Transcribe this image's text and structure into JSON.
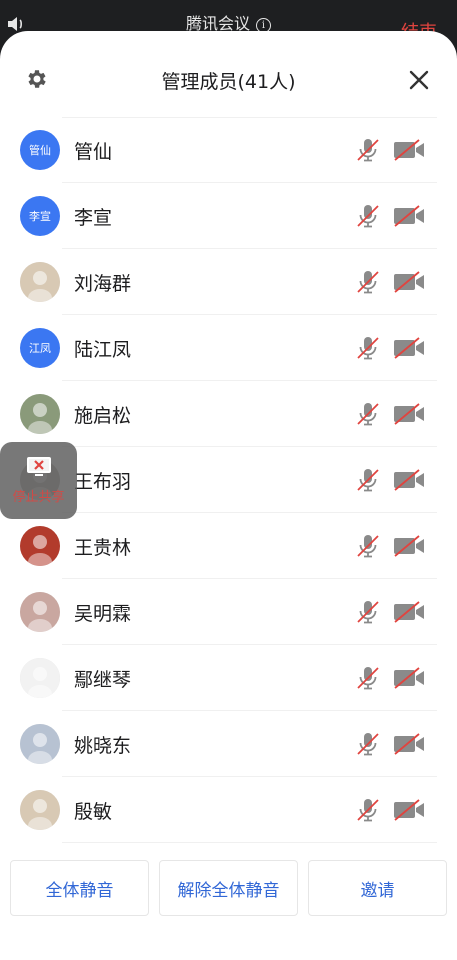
{
  "status_bar": {
    "title": "腾讯会议",
    "end_label": "结束"
  },
  "panel": {
    "title": "管理成员(41人)"
  },
  "members": [
    {
      "name": "管仙",
      "avatar_text": "管仙",
      "avatar_type": "initials"
    },
    {
      "name": "李宣",
      "avatar_text": "李宣",
      "avatar_type": "initials"
    },
    {
      "name": "刘海群",
      "avatar_text": "",
      "avatar_type": "photo"
    },
    {
      "name": "陆江凤",
      "avatar_text": "江凤",
      "avatar_type": "initials"
    },
    {
      "name": "施启松",
      "avatar_text": "",
      "avatar_type": "photo"
    },
    {
      "name": "王布羽",
      "avatar_text": "",
      "avatar_type": "photo"
    },
    {
      "name": "王贵林",
      "avatar_text": "",
      "avatar_type": "photo"
    },
    {
      "name": "吴明霖",
      "avatar_text": "",
      "avatar_type": "photo"
    },
    {
      "name": "鄢继琴",
      "avatar_text": "",
      "avatar_type": "photo"
    },
    {
      "name": "姚晓东",
      "avatar_text": "",
      "avatar_type": "photo"
    },
    {
      "name": "殷敏",
      "avatar_text": "",
      "avatar_type": "photo"
    }
  ],
  "footer": {
    "mute_all": "全体静音",
    "unmute_all": "解除全体静音",
    "invite": "邀请"
  },
  "floating_widget": {
    "label": "停止共享"
  },
  "colors": {
    "accent_blue": "#3b77f2",
    "button_text": "#3167d6",
    "muted_red": "#e0443f",
    "icon_gray": "#8a8a8a"
  }
}
